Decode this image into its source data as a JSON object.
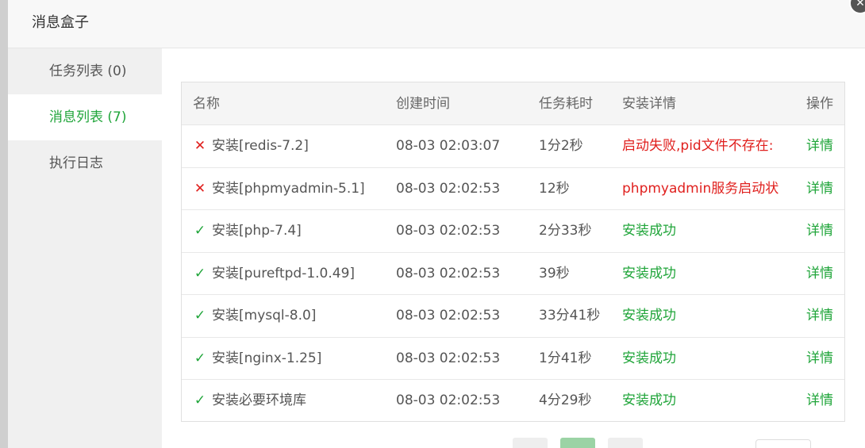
{
  "dialog": {
    "title": "消息盒子",
    "close_icon": "close-icon"
  },
  "sidebar": {
    "items": [
      {
        "label": "任务列表 (0)",
        "active": false
      },
      {
        "label": "消息列表 (7)",
        "active": true
      },
      {
        "label": "执行日志",
        "active": false
      }
    ]
  },
  "table": {
    "headers": {
      "name": "名称",
      "created": "创建时间",
      "duration": "任务耗时",
      "detail": "安装详情",
      "action": "操作"
    },
    "rows": [
      {
        "status": "fail",
        "icon": "✕",
        "name": "安装[redis-7.2]",
        "created": "08-03 02:03:07",
        "duration": "1分2秒",
        "detail": "启动失败,pid文件不存在:",
        "action": "详情"
      },
      {
        "status": "fail",
        "icon": "✕",
        "name": "安装[phpmyadmin-5.1]",
        "created": "08-03 02:02:53",
        "duration": "12秒",
        "detail": "phpmyadmin服务启动状",
        "action": "详情"
      },
      {
        "status": "success",
        "icon": "✓",
        "name": "安装[php-7.4]",
        "created": "08-03 02:02:53",
        "duration": "2分33秒",
        "detail": "安装成功",
        "action": "详情"
      },
      {
        "status": "success",
        "icon": "✓",
        "name": "安装[pureftpd-1.0.49]",
        "created": "08-03 02:02:53",
        "duration": "39秒",
        "detail": "安装成功",
        "action": "详情"
      },
      {
        "status": "success",
        "icon": "✓",
        "name": "安装[mysql-8.0]",
        "created": "08-03 02:02:53",
        "duration": "33分41秒",
        "detail": "安装成功",
        "action": "详情"
      },
      {
        "status": "success",
        "icon": "✓",
        "name": "安装[nginx-1.25]",
        "created": "08-03 02:02:53",
        "duration": "1分41秒",
        "detail": "安装成功",
        "action": "详情"
      },
      {
        "status": "success",
        "icon": "✓",
        "name": "安装必要环境库",
        "created": "08-03 02:02:53",
        "duration": "4分29秒",
        "detail": "安装成功",
        "action": "详情"
      }
    ]
  },
  "colors": {
    "accent": "#20a53a",
    "error": "#e0201e",
    "success_icon": "#20a53a"
  }
}
